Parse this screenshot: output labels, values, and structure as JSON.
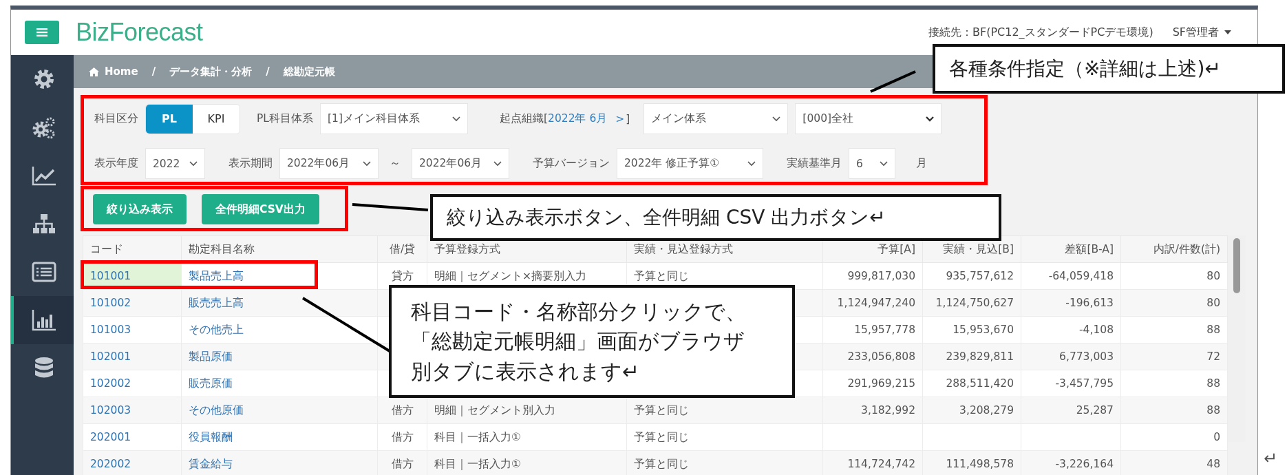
{
  "header": {
    "logo": "BizForecast",
    "connection": "接続先：BF(PC12_スタンダードPCデモ環境)",
    "user": "SF管理者"
  },
  "sidebar": [
    {
      "selected": false
    },
    {
      "selected": false
    },
    {
      "selected": false
    },
    {
      "selected": false
    },
    {
      "selected": false
    },
    {
      "selected": true
    },
    {
      "selected": false
    }
  ],
  "breadcrumb": {
    "items": [
      "Home",
      "データ集計・分析",
      "総勘定元帳"
    ],
    "separator": "/"
  },
  "filters": {
    "account_type": {
      "label": "科目区分",
      "options": [
        {
          "label": "PL",
          "selected": true
        },
        {
          "label": "KPI",
          "selected": false
        }
      ]
    },
    "pl_system": {
      "label": "PL科目体系",
      "value": "[1]メイン科目体系"
    },
    "origin_org": {
      "prefix": "起点組織[",
      "link": "2022年 6月",
      "arrow": ">",
      "suffix": "]",
      "system": "メイン体系",
      "org": "[000]全社"
    },
    "year": {
      "label": "表示年度",
      "value": "2022"
    },
    "period": {
      "label": "表示期間",
      "from": "2022年06月",
      "tilde": "～",
      "to": "2022年06月"
    },
    "budget_version": {
      "label": "予算バージョン",
      "value": "2022年 修正予算①"
    },
    "base_month": {
      "label": "実績基準月",
      "value": "6",
      "unit": "月"
    }
  },
  "buttons": [
    "絞り込み表示",
    "全件明細CSV出力"
  ],
  "table": {
    "columns": [
      "コード",
      "勘定科目名称",
      "借/貸",
      "予算登録方式",
      "実績・見込登録方式",
      "予算[A]",
      "実績・見込[B]",
      "差額[B-A]",
      "内訳/件数(計)"
    ],
    "rows": [
      {
        "highlighted": true,
        "code": "101001",
        "name": "製品売上高",
        "dc": "貸方",
        "budget_method": "明細｜セグメント×摘要別入力",
        "actual_method": "予算と同じ",
        "budget": "999,817,030",
        "actual": "935,757,612",
        "diff": "-64,059,418",
        "count": "80"
      },
      {
        "highlighted": false,
        "code": "101002",
        "name": "販売売上高",
        "budget": "1,124,947,240",
        "actual": "1,124,750,627",
        "diff": "-196,613",
        "count": "80"
      },
      {
        "highlighted": false,
        "code": "101003",
        "name": "その他売上",
        "budget": "15,957,778",
        "actual": "15,953,670",
        "diff": "-4,108",
        "count": "88"
      },
      {
        "highlighted": false,
        "code": "102001",
        "name": "製品原価",
        "budget": "233,056,808",
        "actual": "239,829,811",
        "diff": "6,773,003",
        "count": "72"
      },
      {
        "highlighted": false,
        "code": "102002",
        "name": "販売原価",
        "budget": "291,969,215",
        "actual": "288,511,420",
        "diff": "-3,457,795",
        "count": "88"
      },
      {
        "highlighted": false,
        "code": "102003",
        "name": "その他原価",
        "dc": "借方",
        "budget_method": "明細｜セグメント別入力",
        "actual_method": "予算と同じ",
        "budget": "3,182,992",
        "actual": "3,208,279",
        "diff": "25,287",
        "count": "88"
      },
      {
        "highlighted": false,
        "code": "202001",
        "name": "役員報酬",
        "dc": "借方",
        "budget_method": "科目｜一括入力①",
        "actual_method": "予算と同じ",
        "count": "0"
      },
      {
        "highlighted": false,
        "code": "202002",
        "name": "賃金給与",
        "dc": "借方",
        "budget_method": "科目｜一括入力①",
        "actual_method": "予算と同じ",
        "budget": "114,724,742",
        "actual": "111,498,578",
        "diff": "-3,226,164",
        "count": "48"
      }
    ]
  },
  "callouts": [
    "各種条件指定（※詳細は上述)↵",
    "絞り込み表示ボタン、全件明細 CSV 出力ボタン↵",
    "科目コード・名称部分クリックで、「総勘定元帳明細」画面がブラウザ別タブに表示されます↵"
  ],
  "return_mark": "↵"
}
